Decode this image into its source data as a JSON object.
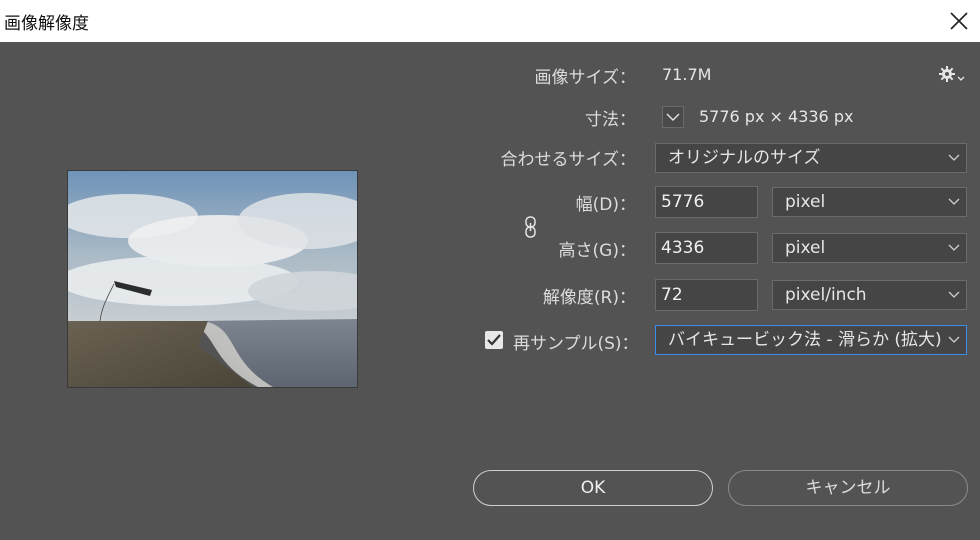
{
  "window": {
    "title": "画像解像度"
  },
  "image_size": {
    "label": "画像サイズ：",
    "value": "71.7M"
  },
  "dimensions": {
    "label": "寸法：",
    "value": "5776 px × 4336 px"
  },
  "fit_to": {
    "label": "合わせるサイズ：",
    "selected": "オリジナルのサイズ"
  },
  "width": {
    "label": "幅(D)：",
    "value": "5776",
    "unit": "pixel"
  },
  "height": {
    "label": "高さ(G)：",
    "value": "4336",
    "unit": "pixel"
  },
  "resolution": {
    "label": "解像度(R)：",
    "value": "72",
    "unit": "pixel/inch"
  },
  "resample": {
    "label": "再サンプル(S)：",
    "checked": true,
    "method": "バイキュービック法 - 滑らか (拡大)"
  },
  "buttons": {
    "ok": "OK",
    "cancel": "キャンセル"
  },
  "icons": {
    "close": "close-icon",
    "gear": "gear-icon",
    "chain": "link-icon",
    "chevron": "chevron-down-icon",
    "check": "check-icon"
  },
  "colors": {
    "background": "#535353",
    "titlebar": "#ffffff",
    "field": "#454545",
    "focus_border": "#3b8beb"
  }
}
